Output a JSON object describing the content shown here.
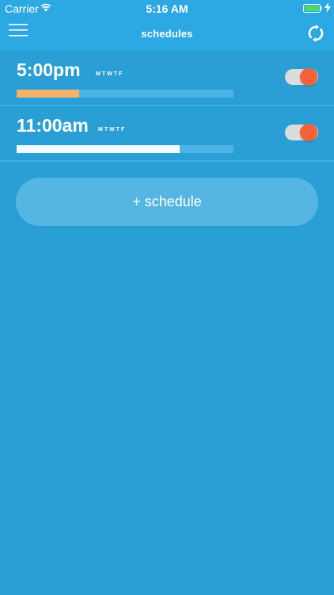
{
  "status_bar": {
    "carrier": "Carrier",
    "time": "5:16 AM",
    "wifi_icon": "wifi-icon",
    "battery_icon": "battery-icon",
    "charge_icon": "charging-bolt-icon",
    "battery_level": 1.0
  },
  "nav": {
    "title": "schedules",
    "menu_icon": "hamburger-menu-icon",
    "refresh_icon": "refresh-icon"
  },
  "schedules": [
    {
      "time": "5:00pm",
      "days": "MTWTF",
      "progress": 0.29,
      "progress_color": "#f4b36d",
      "enabled": true
    },
    {
      "time": "11:00am",
      "days": "MTWTF",
      "progress": 0.75,
      "progress_color": "#f4fbff",
      "enabled": true
    }
  ],
  "add_button": {
    "label": "+ schedule"
  },
  "colors": {
    "background": "#2a9fd6",
    "bar": "#2ca8e2",
    "toggle_knob": "#f5623a",
    "toggle_track": "#dcdcdc",
    "button": "#55b6e3"
  }
}
